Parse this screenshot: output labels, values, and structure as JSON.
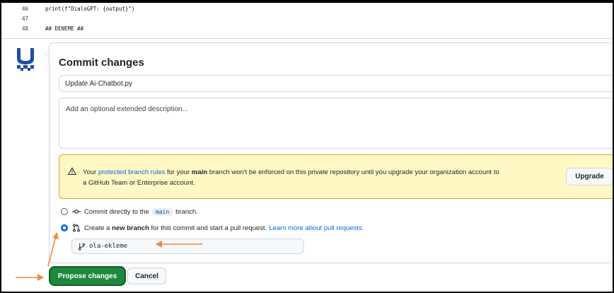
{
  "code": {
    "lines": [
      {
        "number": "46",
        "text": "print(f\"DialoGPT: {output}\")"
      },
      {
        "number": "47",
        "text": ""
      },
      {
        "number": "48",
        "text": "## DENEME ##"
      }
    ]
  },
  "commit": {
    "title": "Commit changes",
    "summary_value": "Update Ai-Chatbot.py",
    "description_placeholder": "Add an optional extended description...",
    "warning": {
      "t1": "Your ",
      "link": "protected branch rules",
      "t2": " for your ",
      "branch": "main",
      "t3": " branch won't be enforced on this private repository until you upgrade your organization account to",
      "t4": "a GitHub Team or Enterprise account.",
      "upgrade_label": "Upgrade"
    },
    "option_direct": {
      "before": "Commit directly to the",
      "branch": "main",
      "after": "branch."
    },
    "option_new": {
      "t1": "Create a",
      "bold": "new branch",
      "t2": "for this commit and start a pull request.",
      "link": "Learn more about pull requests."
    },
    "branch_name": "ola-ekleme",
    "propose_label": "Propose changes",
    "cancel_label": "Cancel"
  },
  "colors": {
    "primary_button": "#1f883d",
    "link": "#0969da",
    "warning_bg": "#fff8c5",
    "annotation_arrow": "#f0883e"
  },
  "icons": {
    "warning": "alert-triangle-icon",
    "commit": "git-commit-icon",
    "pull_request": "git-pull-request-icon",
    "branch": "git-branch-icon"
  }
}
